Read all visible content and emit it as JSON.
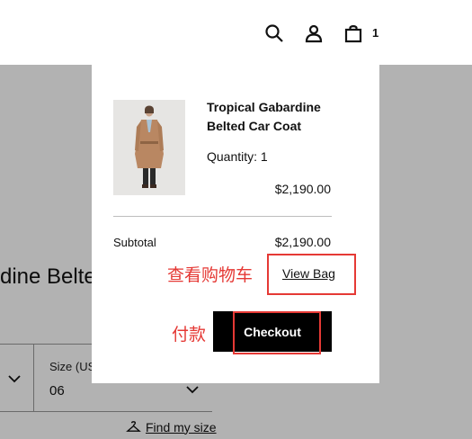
{
  "header": {
    "icons": [
      "search-icon",
      "account-icon",
      "shopping-bag-icon"
    ],
    "bag_count": "1"
  },
  "background_page": {
    "title_fragment": "dine Belte",
    "size_label": "Size (US",
    "size_value": "06",
    "find_my_size": "Find my size"
  },
  "minicart": {
    "product": {
      "name": "Tropical Gabardine Belted Car Coat",
      "quantity_text": "Quantity: 1",
      "price": "$2,190.00"
    },
    "subtotal_label": "Subtotal",
    "subtotal_value": "$2,190.00",
    "view_bag_label": "View Bag",
    "checkout_label": "Checkout"
  },
  "annotations": {
    "view_bag_note": "查看购物车",
    "checkout_note": "付款",
    "color": "#e53935"
  },
  "colors": {
    "overlay": "rgba(0,0,0,0.30)",
    "button": "#000000"
  }
}
